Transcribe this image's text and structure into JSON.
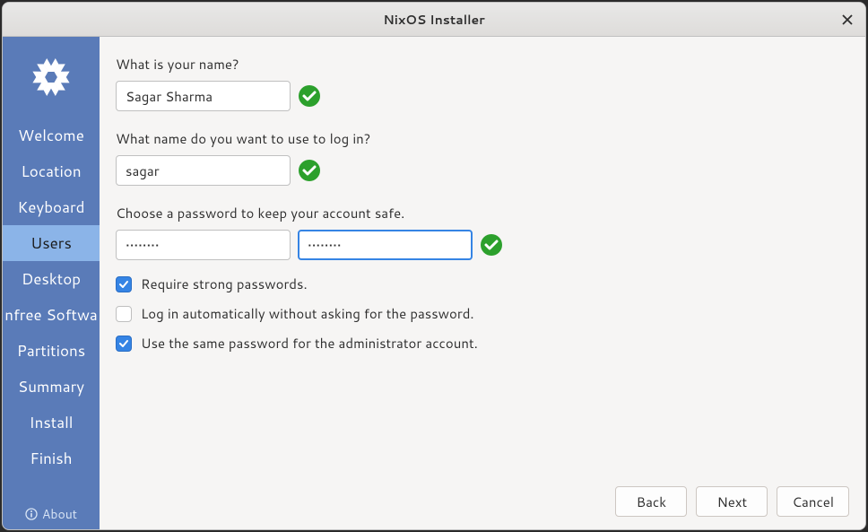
{
  "window": {
    "title": "NixOS Installer"
  },
  "sidebar": {
    "items": [
      {
        "label": "Welcome",
        "active": false
      },
      {
        "label": "Location",
        "active": false
      },
      {
        "label": "Keyboard",
        "active": false
      },
      {
        "label": "Users",
        "active": true
      },
      {
        "label": "Desktop",
        "active": false
      },
      {
        "label": "nfree Softwa",
        "active": false
      },
      {
        "label": "Partitions",
        "active": false
      },
      {
        "label": "Summary",
        "active": false
      },
      {
        "label": "Install",
        "active": false
      },
      {
        "label": "Finish",
        "active": false
      }
    ],
    "about_label": "About"
  },
  "form": {
    "name_label": "What is your name?",
    "name_value": "Sagar Sharma",
    "login_label": "What name do you want to use to log in?",
    "login_value": "sagar",
    "password_label": "Choose a password to keep your account safe.",
    "password_value": "••••••••",
    "password_confirm": "••••••••",
    "strong_pw_label": "Require strong passwords.",
    "autologin_label": "Log in automatically without asking for the password.",
    "admin_pw_label": "Use the same password for the administrator account.",
    "strong_pw_checked": true,
    "autologin_checked": false,
    "admin_pw_checked": true
  },
  "footer": {
    "back_label": "Back",
    "next_label": "Next",
    "cancel_label": "Cancel"
  }
}
